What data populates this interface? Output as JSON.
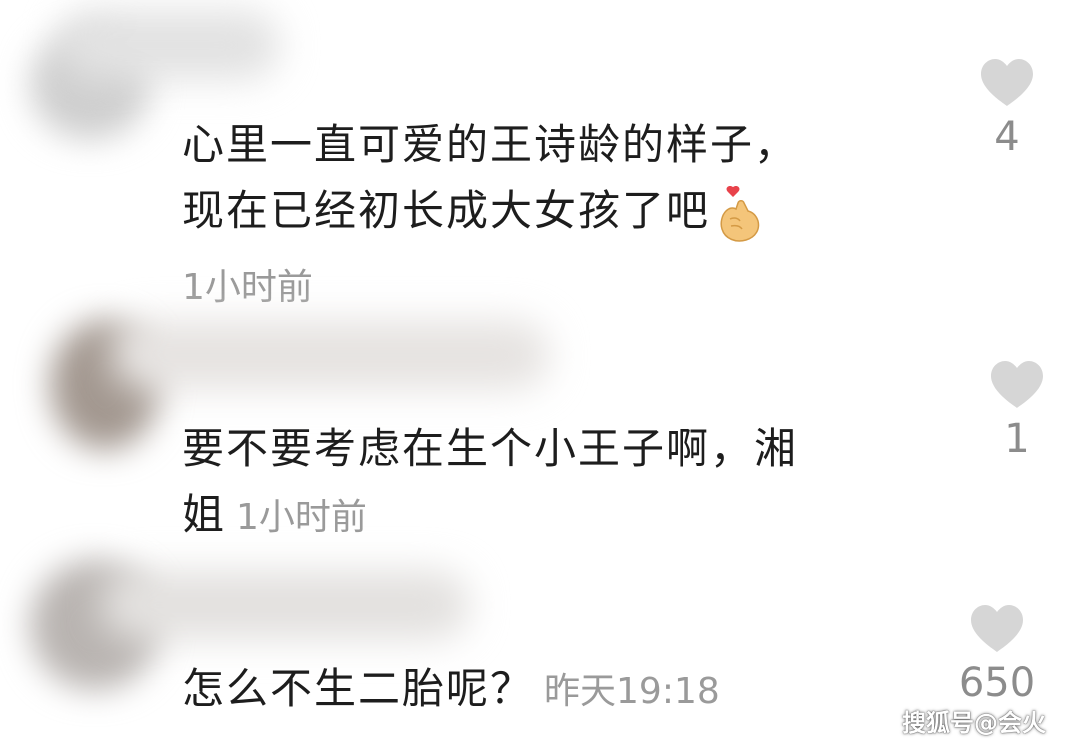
{
  "comments": [
    {
      "text_line1": "心里一直可爱的王诗龄的样子，",
      "text_line2": "现在已经初长成大女孩了吧",
      "emoji": "finger-heart-emoji",
      "time": "1小时前",
      "likes": "4"
    },
    {
      "text_line1": "要不要考虑在生个小王子啊，湘",
      "text_line2": "姐",
      "time": "1小时前",
      "likes": "1"
    },
    {
      "text_line1": "怎么不生二胎呢？",
      "time": "昨天19:18",
      "likes": "650"
    }
  ],
  "watermark": "搜狐号@会火",
  "icons": {
    "like": "heart-icon"
  },
  "colors": {
    "text": "#1d1d1d",
    "meta": "#9a9a9a",
    "heart": "#d6d6d6"
  }
}
